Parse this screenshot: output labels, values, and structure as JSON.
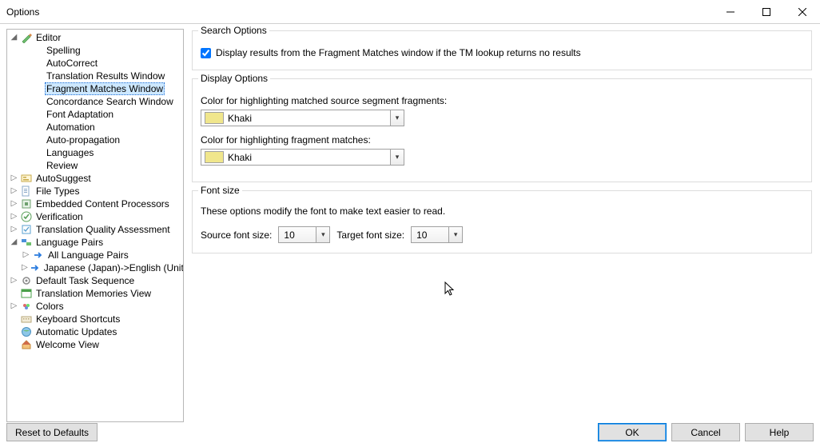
{
  "window_title": "Options",
  "tree": {
    "editor": "Editor",
    "editor_children": {
      "spelling": "Spelling",
      "autocorrect": "AutoCorrect",
      "trw": "Translation Results Window",
      "fmw": "Fragment Matches Window",
      "csw": "Concordance Search Window",
      "font_adaptation": "Font Adaptation",
      "automation": "Automation",
      "autoprop": "Auto-propagation",
      "languages": "Languages",
      "review": "Review"
    },
    "autosuggest": "AutoSuggest",
    "file_types": "File Types",
    "ecp": "Embedded Content Processors",
    "verification": "Verification",
    "tqa": "Translation Quality Assessment",
    "lang_pairs": "Language Pairs",
    "lang_pairs_children": {
      "all": "All Language Pairs",
      "jp_en": "Japanese (Japan)->English (United Kingdom)"
    },
    "default_task": "Default Task Sequence",
    "tmv": "Translation Memories View",
    "colors": "Colors",
    "ks": "Keyboard Shortcuts",
    "au": "Automatic Updates",
    "welcome": "Welcome View"
  },
  "search_options": {
    "legend": "Search Options",
    "checkbox_label": "Display results from the Fragment Matches window if the TM lookup returns no results",
    "checked": true
  },
  "display_options": {
    "legend": "Display Options",
    "label_source": "Color for highlighting matched source segment fragments:",
    "color_source_name": "Khaki",
    "color_source_hex": "#f0e68c",
    "label_matches": "Color for highlighting fragment matches:",
    "color_matches_name": "Khaki",
    "color_matches_hex": "#f0e68c"
  },
  "font_size": {
    "legend": "Font size",
    "desc": "These options modify the font to make text easier to read.",
    "source_label": "Source font size:",
    "source_value": "10",
    "target_label": "Target font size:",
    "target_value": "10"
  },
  "buttons": {
    "reset": "Reset to Defaults",
    "ok": "OK",
    "cancel": "Cancel",
    "help": "Help"
  }
}
